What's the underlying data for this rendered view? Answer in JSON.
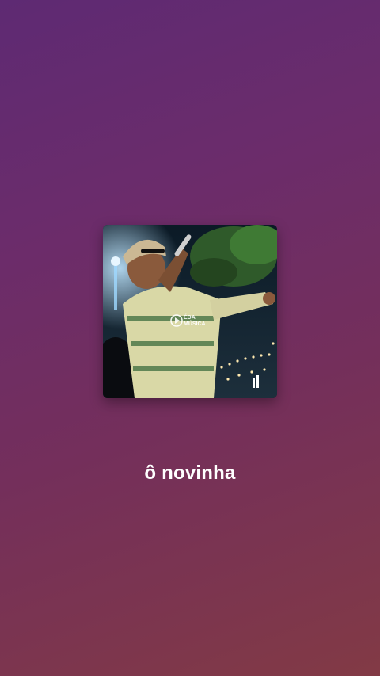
{
  "now_playing": {
    "track_title": "ô novinha",
    "cover_icon": "album-art-image",
    "watermark_text": "ÉDA\nMÚSICA"
  },
  "colors": {
    "background_top": "#5e2a73",
    "background_bottom": "#823a45",
    "title_text": "#ffffff"
  }
}
